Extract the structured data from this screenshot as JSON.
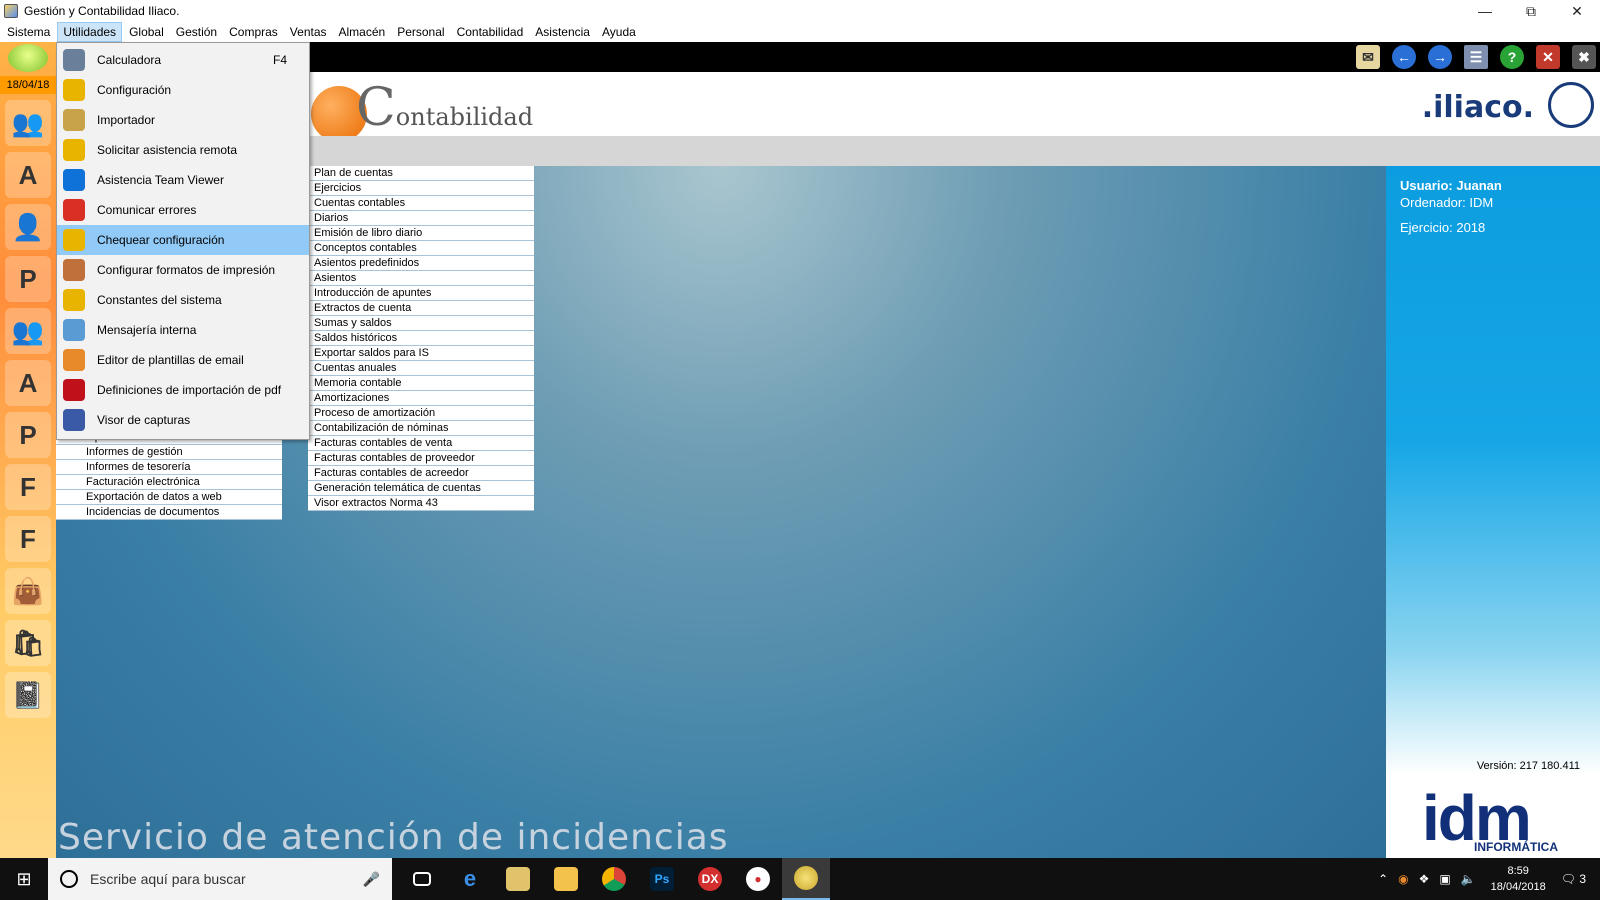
{
  "window": {
    "title": "Gestión y Contabilidad Iliaco."
  },
  "menu": [
    "Sistema",
    "Utilidades",
    "Global",
    "Gestión",
    "Compras",
    "Ventas",
    "Almacén",
    "Personal",
    "Contabilidad",
    "Asistencia",
    "Ayuda"
  ],
  "sidebar": {
    "date": "18/04/18"
  },
  "header": {
    "logo_initial": "C",
    "logo_rest": "ontabilidad",
    "brand": ".iliaco."
  },
  "dropdown": [
    {
      "label": "Calculadora",
      "key": "F4",
      "color": "#6a7f9a",
      "icon": "calculator-icon"
    },
    {
      "label": "Configuración",
      "key": "",
      "color": "#e8b400",
      "icon": "gear-icon"
    },
    {
      "label": "Importador",
      "key": "",
      "color": "#c9a34a",
      "icon": "import-icon"
    },
    {
      "label": "Solicitar asistencia remota",
      "key": "",
      "color": "#e8b400",
      "icon": "remote-help-icon"
    },
    {
      "label": "Asistencia Team Viewer",
      "key": "",
      "color": "#0e72d8",
      "icon": "teamviewer-icon"
    },
    {
      "label": "Comunicar errores",
      "key": "",
      "color": "#d93025",
      "icon": "error-icon"
    },
    {
      "label": "Chequear configuración",
      "key": "",
      "color": "#e8b400",
      "icon": "check-config-icon"
    },
    {
      "label": "Configurar formatos de impresión",
      "key": "",
      "color": "#c0703a",
      "icon": "print-format-icon"
    },
    {
      "label": "Constantes del sistema",
      "key": "",
      "color": "#e8b400",
      "icon": "constants-icon"
    },
    {
      "label": "Mensajería interna",
      "key": "",
      "color": "#5a9bd4",
      "icon": "mail-icon"
    },
    {
      "label": "Editor de plantillas de email",
      "key": "",
      "color": "#e88a2a",
      "icon": "email-template-icon"
    },
    {
      "label": "Definiciones de importación de pdf",
      "key": "",
      "color": "#c0101a",
      "icon": "pdf-icon"
    },
    {
      "label": "Visor de capturas",
      "key": "",
      "color": "#3a5aa8",
      "icon": "capture-viewer-icon"
    }
  ],
  "left_list": [
    "Tipos de incidencia",
    "Informes de gestión",
    "Informes de tesorería",
    "Facturación electrónica",
    "Exportación de datos a web",
    "Incidencias de documentos"
  ],
  "right_list": [
    "Plan de cuentas",
    "Ejercicios",
    "Cuentas contables",
    "Diarios",
    "Emisión de libro diario",
    "Conceptos contables",
    "Asientos predefinidos",
    "Asientos",
    "Introducción de apuntes",
    "Extractos de cuenta",
    "Sumas y saldos",
    "Saldos históricos",
    "Exportar saldos para IS",
    "Cuentas anuales",
    "Memoria contable",
    "Amortizaciones",
    "Proceso de amortización",
    "Contabilización de nóminas",
    "Facturas contables de venta",
    "Facturas contables de proveedor",
    "Facturas contables de acreedor",
    "Generación telemática de cuentas",
    "Visor extractos Norma 43"
  ],
  "info": {
    "user": "Usuario: Juanan",
    "computer": "Ordenador: IDM",
    "year": "Ejercicio: 2018",
    "version": "Versión: 217 180.411",
    "idm_logo": "idm",
    "idm_sub": "INFORMÁTICA"
  },
  "footer": "Servicio de atención de incidencias",
  "taskbar": {
    "search_placeholder": "Escribe aquí para buscar",
    "time": "8:59",
    "date": "18/04/2018",
    "notifications": "3"
  }
}
